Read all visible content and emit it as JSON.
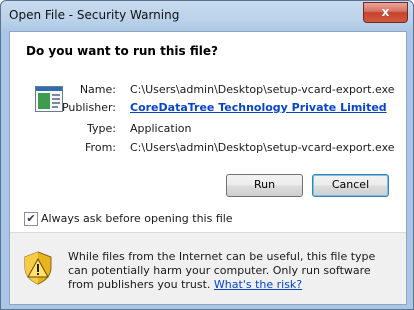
{
  "window": {
    "title": "Open File - Security Warning",
    "close_glyph": "x"
  },
  "dialog": {
    "heading": "Do you want to run this file?",
    "fields": [
      {
        "label": "Name:",
        "value": "C:\\Users\\admin\\Desktop\\setup-vcard-export.exe"
      },
      {
        "label": "Publisher:",
        "value": "CoreDataTree Technology Private Limited"
      },
      {
        "label": "Type:",
        "value": "Application"
      },
      {
        "label": "From:",
        "value": "C:\\Users\\admin\\Desktop\\setup-vcard-export.exe"
      }
    ],
    "buttons": {
      "run": "Run",
      "cancel": "Cancel"
    },
    "checkbox": {
      "label": "Always ask before opening this file",
      "checked": true
    },
    "warning": {
      "text": "While files from the Internet can be useful, this file type can potentially harm your computer. Only run software from publishers you trust.",
      "link": "What's the risk?"
    }
  },
  "icons": {
    "file": "application-file-icon",
    "shield": "warning-shield-icon",
    "check": "✔"
  },
  "colors": {
    "link": "#0645c8",
    "close_button": "#c5432f",
    "title_bar": "#b9d1ea"
  }
}
